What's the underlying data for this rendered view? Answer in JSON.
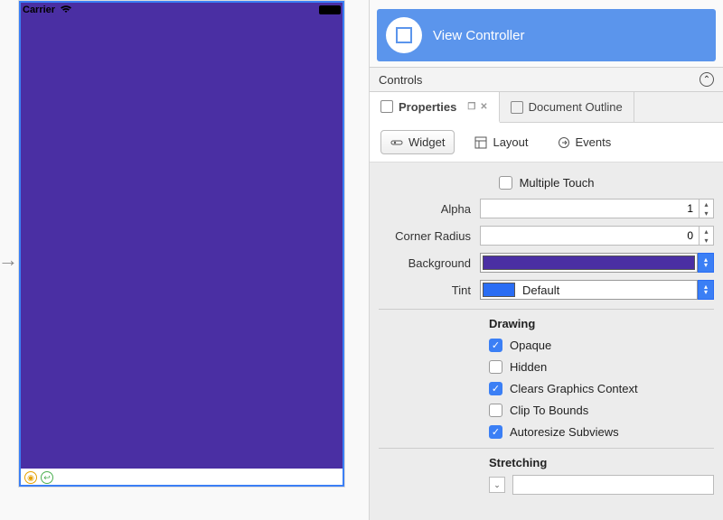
{
  "statusbar": {
    "carrier": "Carrier"
  },
  "selection": {
    "title": "View Controller"
  },
  "controlsBar": {
    "label": "Controls"
  },
  "paneTabs": {
    "properties": "Properties",
    "documentOutline": "Document Outline"
  },
  "subTabs": {
    "widget": "Widget",
    "layout": "Layout",
    "events": "Events"
  },
  "properties": {
    "multipleTouchLabel": "Multiple Touch",
    "alphaLabel": "Alpha",
    "alphaValue": "1",
    "cornerRadiusLabel": "Corner Radius",
    "cornerRadiusValue": "0",
    "backgroundLabel": "Background",
    "backgroundColor": "#4a2fa3",
    "tintLabel": "Tint",
    "tintText": "Default",
    "drawing": {
      "header": "Drawing",
      "opaque": "Opaque",
      "hidden": "Hidden",
      "clearsGraphicsContext": "Clears Graphics Context",
      "clipToBounds": "Clip To Bounds",
      "autoresizeSubviews": "Autoresize Subviews"
    },
    "stretching": {
      "header": "Stretching"
    }
  }
}
